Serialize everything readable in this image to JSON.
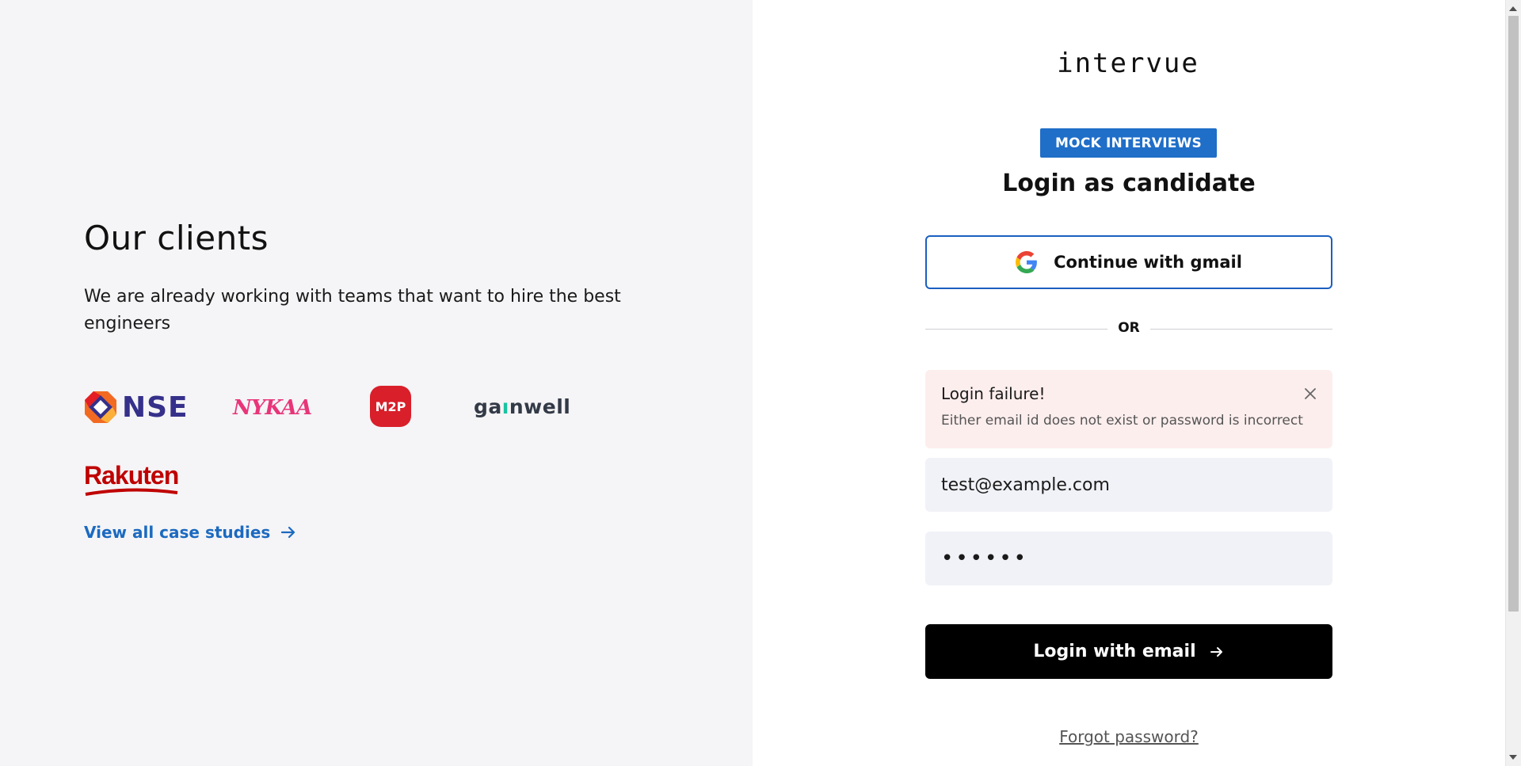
{
  "clients": {
    "title": "Our clients",
    "description": "We are already working with teams that want to hire the best engineers",
    "logos": {
      "nse": "NSE",
      "nykaa": "NYKAA",
      "m2p": "M2P",
      "gainwell_prefix": "ga",
      "gainwell_accent": "ı",
      "gainwell_suffix": "nwell",
      "rakuten": "Rakuten"
    },
    "case_studies_link": "View all case studies"
  },
  "brand": {
    "logo_text": "intervue"
  },
  "login": {
    "badge": "MOCK INTERVIEWS",
    "title": "Login as candidate",
    "gmail_button": "Continue with gmail",
    "divider": "OR",
    "alert": {
      "title": "Login failure!",
      "message": "Either email id does not exist or password is incorrect"
    },
    "email_value": "test@example.com",
    "password_value": "••••••",
    "submit_button": "Login with email",
    "forgot_password": "Forgot password?"
  },
  "colors": {
    "accent_blue": "#1f6ec8",
    "link_blue": "#1b6ac0",
    "alert_bg": "#fdeeee",
    "input_bg": "#f1f2f7",
    "left_bg": "#f5f4f6"
  },
  "icons": {
    "google": "google-g-icon",
    "arrow": "arrow-right-icon",
    "close": "close-icon",
    "nse": "nse-octagon-icon"
  }
}
